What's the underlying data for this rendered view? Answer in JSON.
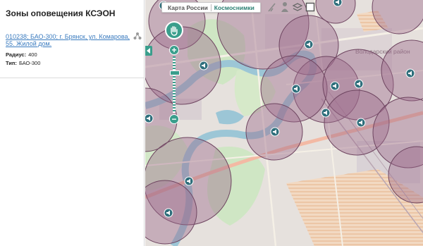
{
  "panel": {
    "title": "Зоны оповещения КСЭОН",
    "link": "010238; БАО-300; г. Брянск, ул. Комарова, 55. Жилой дом.",
    "radius_label": "Радиус:",
    "radius_value": "400",
    "type_label": "Тип:",
    "type_value": "БАО-300"
  },
  "map": {
    "switch": {
      "left_label": "Карта России",
      "right_label": "Космоснимки",
      "active": "right"
    },
    "district_label": "Володарский район",
    "colors": {
      "accent": "#3a9e8c",
      "zone_fill": "#9b6a8a",
      "zone_stroke": "#6e4560",
      "marker": "#2f6f7c"
    },
    "zoom_level_fraction": 0.72,
    "tools": [
      "ruler-icon",
      "person-icon",
      "layers-icon",
      "square-icon"
    ],
    "alert_zones": [
      {
        "id": "z1"
      },
      {
        "id": "z2"
      },
      {
        "id": "z3"
      },
      {
        "id": "z4"
      },
      {
        "id": "z5"
      },
      {
        "id": "z6"
      },
      {
        "id": "z7"
      },
      {
        "id": "z8"
      },
      {
        "id": "z9"
      },
      {
        "id": "z10"
      },
      {
        "id": "z11"
      },
      {
        "id": "z12"
      },
      {
        "id": "z13"
      },
      {
        "id": "z14"
      },
      {
        "id": "z15"
      },
      {
        "id": "z16"
      },
      {
        "id": "z17"
      },
      {
        "id": "z18"
      }
    ]
  }
}
